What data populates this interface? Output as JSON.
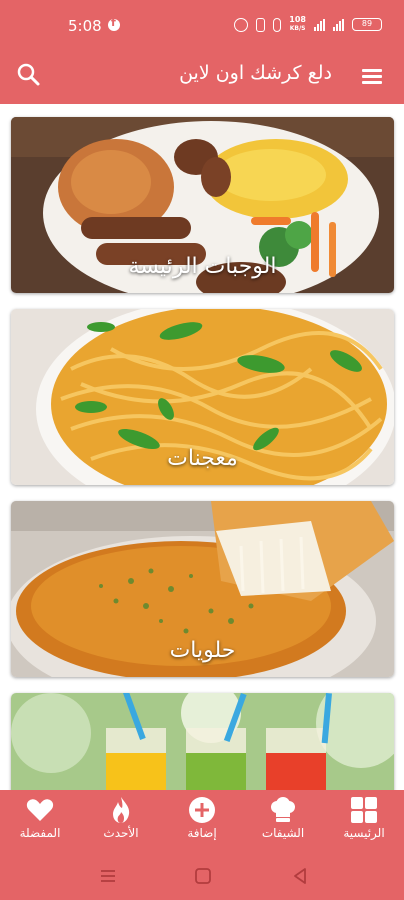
{
  "status_bar": {
    "time": "5:08",
    "speed": "108",
    "speed_unit": "KB/S",
    "battery": "89"
  },
  "app_bar": {
    "title": "دلع كرشك اون لاين",
    "menu_icon": "hamburger-icon",
    "search_icon": "search-icon"
  },
  "categories": [
    {
      "label": "الوجبات الرئيسة"
    },
    {
      "label": "معجنات"
    },
    {
      "label": "حلويات"
    },
    {
      "label": ""
    }
  ],
  "bottom_nav": {
    "items": [
      {
        "label": "الرئيسية",
        "icon": "grid-icon"
      },
      {
        "label": "الشيفات",
        "icon": "chef-hat-icon"
      },
      {
        "label": "إضافة",
        "icon": "add-circle-icon"
      },
      {
        "label": "الأحدث",
        "icon": "flame-icon"
      },
      {
        "label": "المفضلة",
        "icon": "heart-icon"
      }
    ]
  },
  "colors": {
    "primary": "#e46466",
    "white": "#ffffff"
  }
}
